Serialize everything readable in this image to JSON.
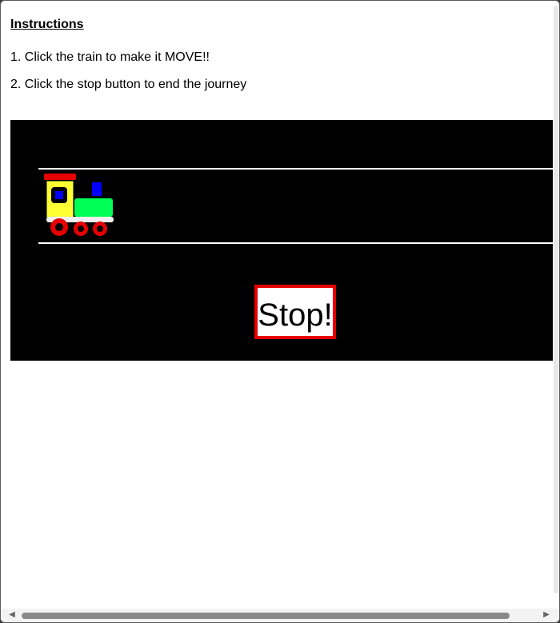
{
  "instructions": {
    "heading": "Instructions",
    "steps": [
      "1. Click the train to make it MOVE!!",
      "2. Click the stop button to end the journey"
    ]
  },
  "scene": {
    "train_icon": "toy-train-icon",
    "stop_button_label": "Stop!"
  },
  "colors": {
    "scene_background": "#000000",
    "rail": "#ffffff",
    "train_cab": "#ffff33",
    "train_boiler": "#00ff55",
    "train_window": "#0000ff",
    "train_roof_and_wheels": "#e60000",
    "stop_border": "#e60000"
  },
  "scrollbar": {
    "left_arrow": "◀",
    "right_arrow": "▶"
  }
}
